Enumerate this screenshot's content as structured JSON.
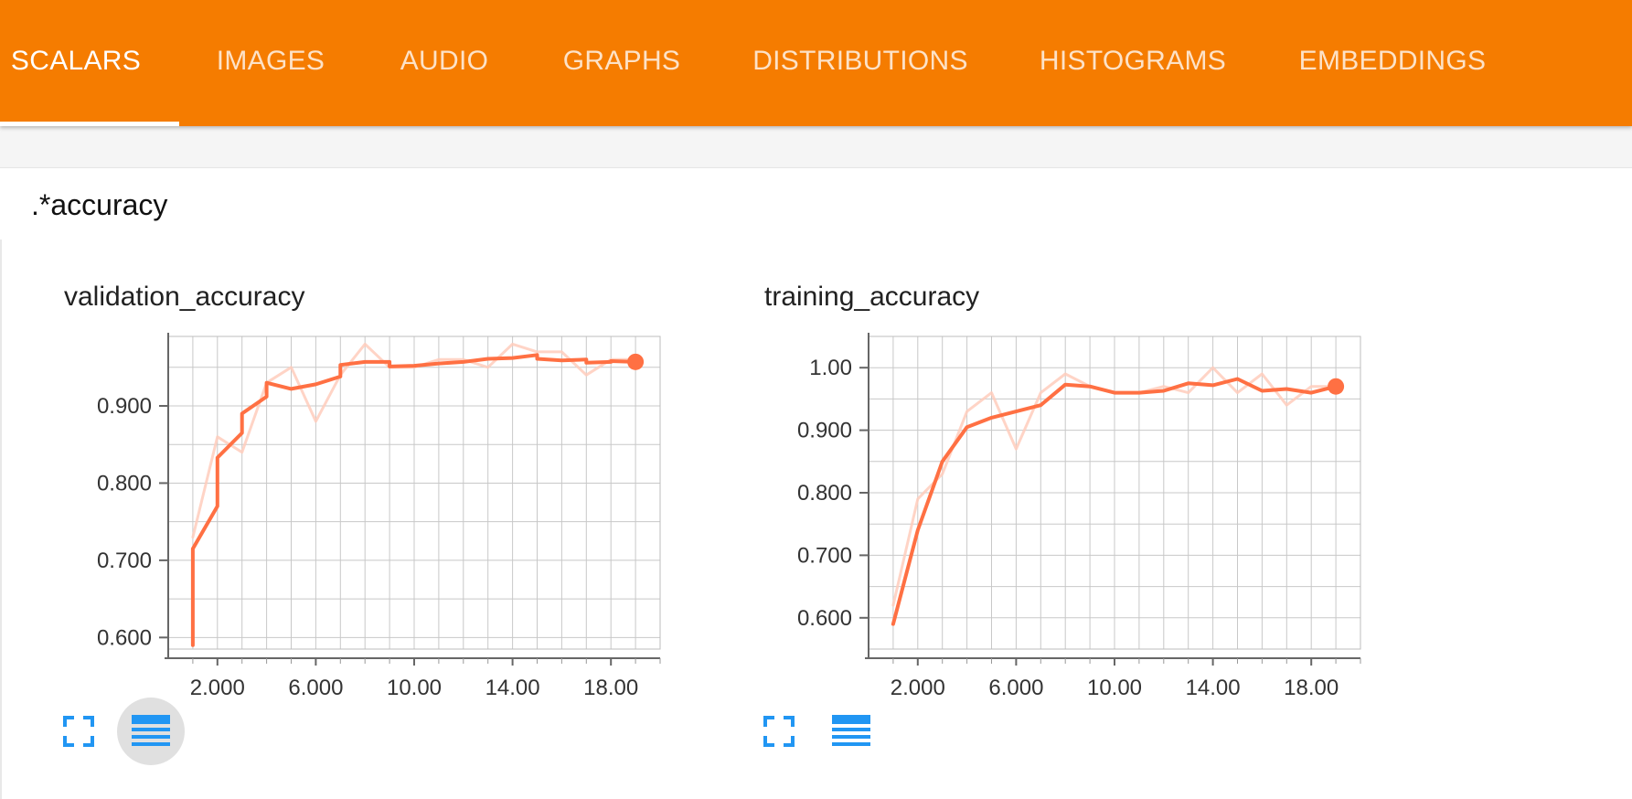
{
  "nav": {
    "tabs": [
      {
        "label": "SCALARS",
        "active": true
      },
      {
        "label": "IMAGES",
        "active": false
      },
      {
        "label": "AUDIO",
        "active": false
      },
      {
        "label": "GRAPHS",
        "active": false
      },
      {
        "label": "DISTRIBUTIONS",
        "active": false
      },
      {
        "label": "HISTOGRAMS",
        "active": false
      },
      {
        "label": "EMBEDDINGS",
        "active": false
      }
    ]
  },
  "filter": {
    "regex_value": ".*accuracy"
  },
  "colors": {
    "header": "#f57c00",
    "series": "#ff7043",
    "series_raw": "#ffccbc",
    "icon": "#2196f3"
  },
  "chart_data": [
    {
      "type": "line",
      "title": "validation_accuracy",
      "xlim": [
        0,
        20
      ],
      "ylim": [
        0.585,
        0.99
      ],
      "x_ticks": [
        "2.000",
        "6.000",
        "10.00",
        "14.00",
        "18.00"
      ],
      "y_ticks": [
        "0.600",
        "0.700",
        "0.800",
        "0.900"
      ],
      "step_style": true,
      "series": [
        {
          "role": "raw",
          "x": [
            1,
            2,
            3,
            4,
            5,
            6,
            7,
            8,
            9,
            10,
            11,
            12,
            13,
            14,
            15,
            16,
            17,
            18,
            19
          ],
          "y": [
            0.73,
            0.86,
            0.84,
            0.93,
            0.95,
            0.88,
            0.94,
            0.98,
            0.95,
            0.95,
            0.96,
            0.96,
            0.95,
            0.98,
            0.97,
            0.97,
            0.94,
            0.96,
            0.96
          ]
        },
        {
          "role": "smoothed",
          "x": [
            1,
            1,
            2,
            2,
            3,
            3,
            4,
            4,
            5,
            6,
            7,
            7,
            8,
            9,
            9,
            10,
            11,
            12,
            13,
            13,
            14,
            15,
            15,
            16,
            17,
            17,
            18,
            18,
            19
          ],
          "y": [
            0.59,
            0.715,
            0.77,
            0.833,
            0.865,
            0.89,
            0.912,
            0.93,
            0.922,
            0.928,
            0.938,
            0.953,
            0.957,
            0.957,
            0.951,
            0.952,
            0.955,
            0.957,
            0.961,
            0.961,
            0.962,
            0.966,
            0.961,
            0.959,
            0.96,
            0.956,
            0.957,
            0.958,
            0.957
          ]
        }
      ]
    },
    {
      "type": "line",
      "title": "training_accuracy",
      "xlim": [
        0,
        20
      ],
      "ylim": [
        0.55,
        1.05
      ],
      "x_ticks": [
        "2.000",
        "6.000",
        "10.00",
        "14.00",
        "18.00"
      ],
      "y_ticks": [
        "0.600",
        "0.700",
        "0.800",
        "0.900",
        "1.00"
      ],
      "step_style": false,
      "series": [
        {
          "role": "raw",
          "x": [
            1,
            2,
            3,
            4,
            5,
            6,
            7,
            8,
            9,
            10,
            11,
            12,
            13,
            14,
            15,
            16,
            17,
            18,
            19
          ],
          "y": [
            0.62,
            0.79,
            0.83,
            0.93,
            0.96,
            0.87,
            0.96,
            0.99,
            0.97,
            0.96,
            0.96,
            0.97,
            0.96,
            1.0,
            0.96,
            0.99,
            0.94,
            0.97,
            0.97
          ]
        },
        {
          "role": "smoothed",
          "x": [
            1,
            2,
            3,
            4,
            5,
            6,
            7,
            8,
            9,
            10,
            11,
            12,
            13,
            14,
            15,
            16,
            17,
            18,
            19
          ],
          "y": [
            0.59,
            0.74,
            0.85,
            0.905,
            0.92,
            0.93,
            0.94,
            0.973,
            0.97,
            0.96,
            0.96,
            0.963,
            0.975,
            0.972,
            0.982,
            0.963,
            0.966,
            0.96,
            0.97
          ]
        }
      ]
    }
  ],
  "chart_actions": [
    {
      "fullscreen_icon": "fullscreen-icon",
      "list_icon": "list-icon",
      "list_active": true
    },
    {
      "fullscreen_icon": "fullscreen-icon",
      "list_icon": "list-icon",
      "list_active": false
    }
  ]
}
